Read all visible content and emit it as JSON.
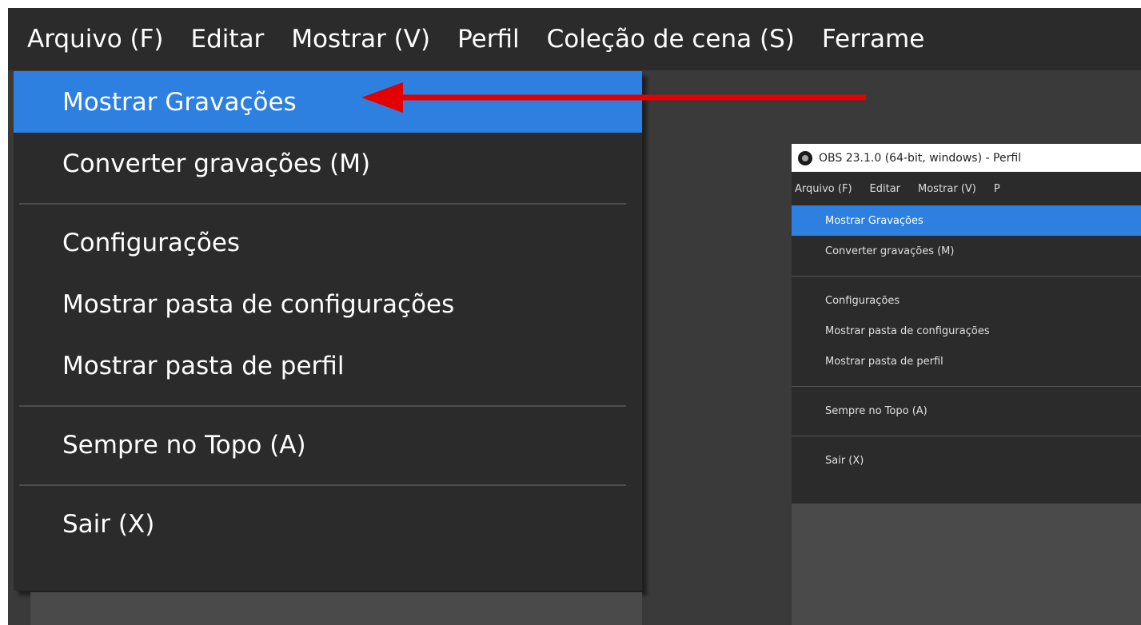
{
  "menubar": [
    "Arquivo (F)",
    "Editar",
    "Mostrar (V)",
    "Perfil",
    "Coleção de cena (S)",
    "Ferrame"
  ],
  "dropdown": {
    "items": [
      "Mostrar Gravações",
      "Converter gravações (M)",
      "Configurações",
      "Mostrar pasta de configurações",
      "Mostrar pasta de perfil",
      "Sempre no Topo (A)",
      "Sair (X)"
    ]
  },
  "inner": {
    "title": "OBS 23.1.0 (64-bit, windows) - Perfil",
    "menubar": [
      "Arquivo (F)",
      "Editar",
      "Mostrar (V)",
      "P"
    ],
    "items": [
      "Mostrar Gravações",
      "Converter gravações (M)",
      "Configurações",
      "Mostrar pasta de configurações",
      "Mostrar pasta de perfil",
      "Sempre no Topo (A)",
      "Sair (X)"
    ]
  },
  "colors": {
    "highlight": "#2d7fe0",
    "menu_bg": "#2b2b2b",
    "arrow": "#e30000"
  },
  "icons": [
    "obs-logo-icon",
    "red-arrow-annotation"
  ]
}
